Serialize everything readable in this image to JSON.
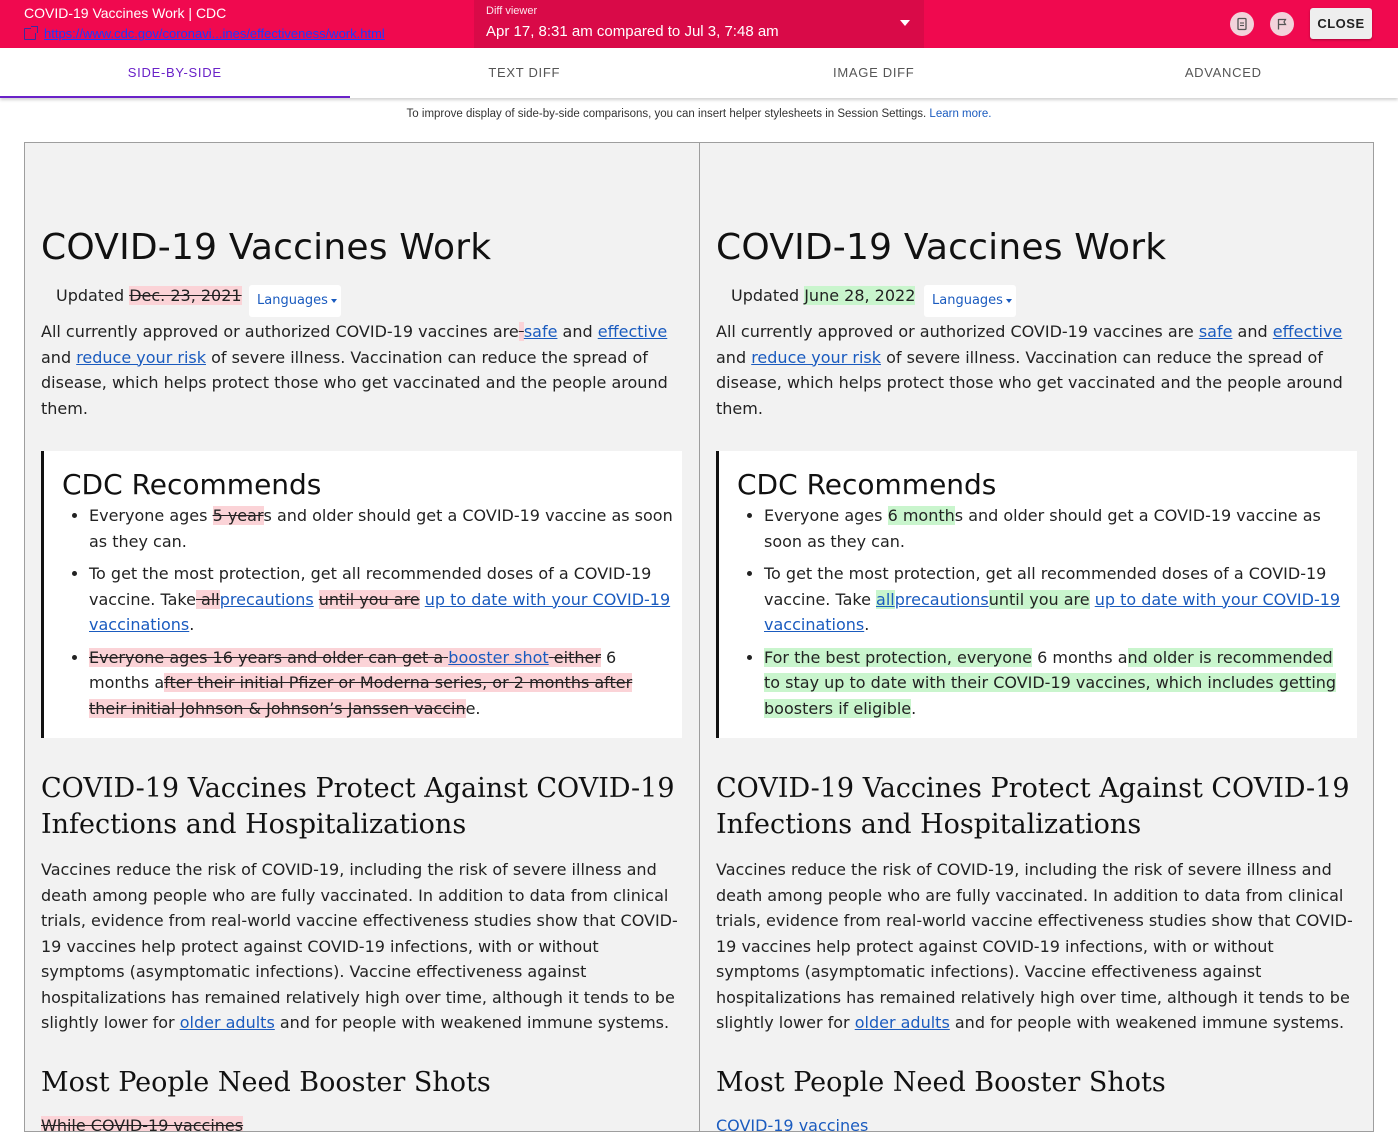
{
  "topbar": {
    "page_title": "COVID-19 Vaccines Work | CDC",
    "url": "https://www.cdc.gov/coronavi...ines/effectiveness/work.html",
    "diff_viewer_label": "Diff viewer",
    "diff_viewer_value": "Apr 17, 8:31 am compared to Jul 3, 7:48 am",
    "close_label": "CLOSE"
  },
  "tabs": [
    "SIDE-BY-SIDE",
    "TEXT DIFF",
    "IMAGE DIFF",
    "ADVANCED"
  ],
  "hint": {
    "text": "To improve display of side-by-side comparisons, you can insert helper stylesheets in Session Settings.",
    "link": "Learn more."
  },
  "common": {
    "heading": "COVID-19 Vaccines Work",
    "updated_label": "Updated",
    "languages_label": "Languages",
    "rec_heading": "CDC Recommends",
    "h2": "COVID-19 Vaccines Protect Against COVID-19 Infections and Hospitalizations",
    "body2_text": "Vaccines reduce the risk of COVID-19, including the risk of severe illness and death among people who are fully vaccinated. In addition to data from clinical trials, evidence from real-world vaccine effectiveness studies show that COVID-19 vaccines help protect against COVID-19 infections, with or without symptoms (asymptomatic infections). Vaccine effectiveness against hospitalizations has remained relatively high over time, although it tends to be slightly lower for",
    "body2_link": "older adults",
    "body2_tail": "and for people with weakened immune systems.",
    "h3": "Most People Need Booster Shots"
  },
  "left": {
    "updated_date": "Dec. 23, 2021",
    "intro_start": "All currently approved or authorized COVID-19 vaccines are",
    "intro_safe": "safe",
    "intro_and": "and",
    "intro_effective": "effective",
    "intro_and2": "and",
    "intro_reduce": "reduce your risk",
    "intro_end": "of severe illness. Vaccination can reduce the spread of disease, which helps protect those who get vaccinated and the people around them.",
    "b1_pre": "Everyone ages",
    "b1_del": "5 year",
    "b1_post": "s and older should get a COVID-19 vaccine as soon as they can.",
    "b2_pre": "To get the most protection, get all recommended doses of a COVID-19 vaccine. Take",
    "b2_del1": " all",
    "b2_link1": "precautions",
    "b2_del2": "until you are",
    "b2_link2": "up to date with your COVID-19 vaccinations",
    "b2_post": ".",
    "b3_del1": "Everyone ages 16 years and older can get a",
    "b3_link": "booster shot",
    "b3_del2": "either",
    "b3_mid": "6 months a",
    "b3_del3": "fter their initial Pfizer or Moderna series, or 2 months after their initial Johnson & Johnson’s Janssen vaccin",
    "b3_post": "e.",
    "body3_start": "While COVID-19 vaccines"
  },
  "right": {
    "updated_date": "June 28, 2022",
    "intro_start": "All currently approved or authorized COVID-19 vaccines are",
    "intro_safe": "safe",
    "intro_and": "and",
    "intro_effective": "effective",
    "intro_and2": "and",
    "intro_reduce": "reduce your risk",
    "intro_end": "of severe illness. Vaccination can reduce the spread of disease, which helps protect those who get vaccinated and the people around them.",
    "b1_pre": "Everyone ages",
    "b1_ins": "6 month",
    "b1_post": "s and older should get a COVID-19 vaccine as soon as they can.",
    "b2_pre": "To get the most protection, get all recommended doses of a COVID-19 vaccine. Take",
    "b2_ins1": "all",
    "b2_link1": "precautions",
    "b2_ins2a": "until",
    "b2_ins2b": "you are",
    "b2_link2": "up to date with your COVID-19 vaccinations",
    "b2_post": ".",
    "b3_ins1": "For the best protection, everyone",
    "b3_mid": "6 months a",
    "b3_ins2": "nd older is recommended to stay up to date with their COVID-19 vaccines, which includes getting boosters if eligible",
    "b3_post": ".",
    "body3_start": "COVID-19 vaccines"
  },
  "colors": {
    "topbar": "#f0094f",
    "tab_accent": "#6a22c8",
    "link": "#1a5bbf",
    "deleted": "#fbd3d7",
    "inserted": "#c9f5cd"
  }
}
